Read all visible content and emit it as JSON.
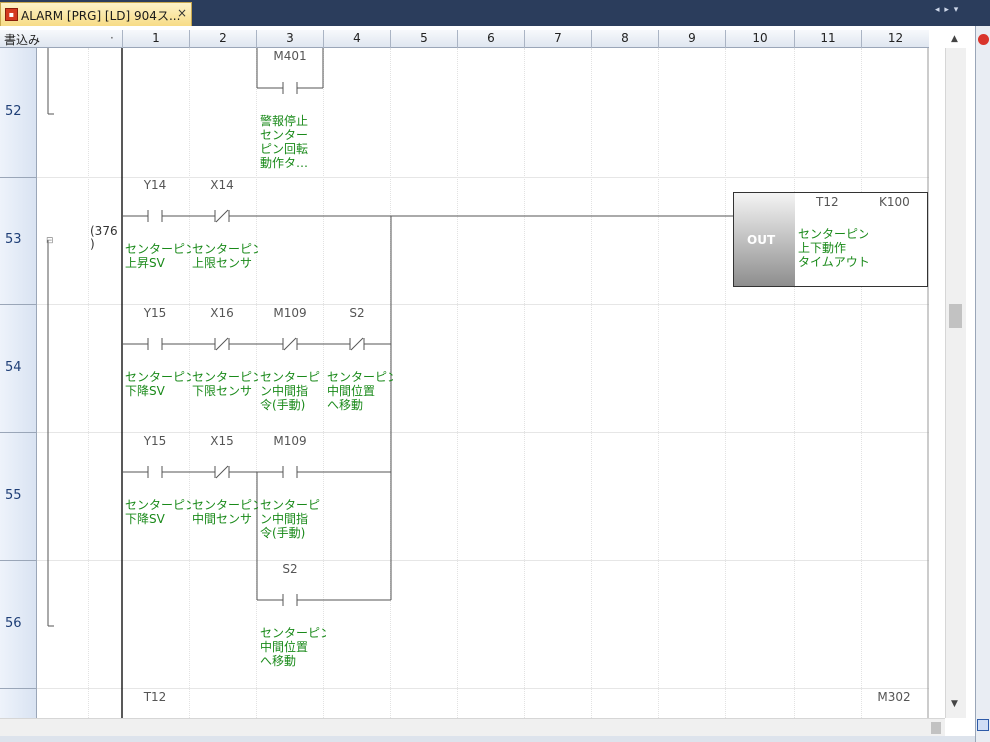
{
  "tab": {
    "title": "ALARM [PRG] [LD] 904ス...",
    "close": "×",
    "nav_arrows": "◂ ▸ ▾"
  },
  "header": {
    "mode_label": "書込み",
    "mode_marker": "·",
    "columns": [
      "1",
      "2",
      "3",
      "4",
      "5",
      "6",
      "7",
      "8",
      "9",
      "10",
      "11",
      "12"
    ]
  },
  "steps": [
    "52",
    "53",
    "54",
    "55",
    "56"
  ],
  "step_ref": "(376\n)",
  "rungs": {
    "r52": {
      "contact": {
        "device": "M401",
        "comment": [
          "警報停止",
          "センター",
          "ピン回転",
          "動作タ…"
        ]
      }
    },
    "r53": {
      "contacts": [
        {
          "device": "Y14",
          "type": "NO",
          "comment": [
            "センターピン",
            "上昇SV"
          ]
        },
        {
          "device": "X14",
          "type": "NC",
          "comment": [
            "センターピン",
            "上限センサ"
          ]
        }
      ],
      "coil": {
        "instruction": "OUT",
        "device": "T12",
        "setting": "K100",
        "comment": [
          "センターピン",
          "上下動作",
          "タイムアウト"
        ]
      }
    },
    "r54": {
      "contacts": [
        {
          "device": "Y15",
          "type": "NO",
          "comment": [
            "センターピン",
            "下降SV"
          ]
        },
        {
          "device": "X16",
          "type": "NC",
          "comment": [
            "センターピン",
            "下限センサ"
          ]
        },
        {
          "device": "M109",
          "type": "NC",
          "comment": [
            "センターピ",
            "ン中間指",
            "令(手動)"
          ]
        },
        {
          "device": "S2",
          "type": "NC",
          "comment": [
            "センターピン",
            "中間位置",
            "へ移動"
          ]
        }
      ]
    },
    "r55": {
      "contacts": [
        {
          "device": "Y15",
          "type": "NO",
          "comment": [
            "センターピン",
            "下降SV"
          ]
        },
        {
          "device": "X15",
          "type": "NC",
          "comment": [
            "センターピン",
            "中間センサ"
          ]
        },
        {
          "device": "M109",
          "type": "NO",
          "comment": [
            "センターピ",
            "ン中間指",
            "令(手動)"
          ]
        }
      ]
    },
    "r56": {
      "contacts": [
        {
          "device": "S2",
          "type": "NO",
          "comment": [
            "センターピン",
            "中間位置",
            "へ移動"
          ]
        }
      ]
    },
    "r57": {
      "left_device": "T12",
      "right_device": "M302"
    }
  },
  "scroll": {
    "up": "▲",
    "down": "▼"
  }
}
